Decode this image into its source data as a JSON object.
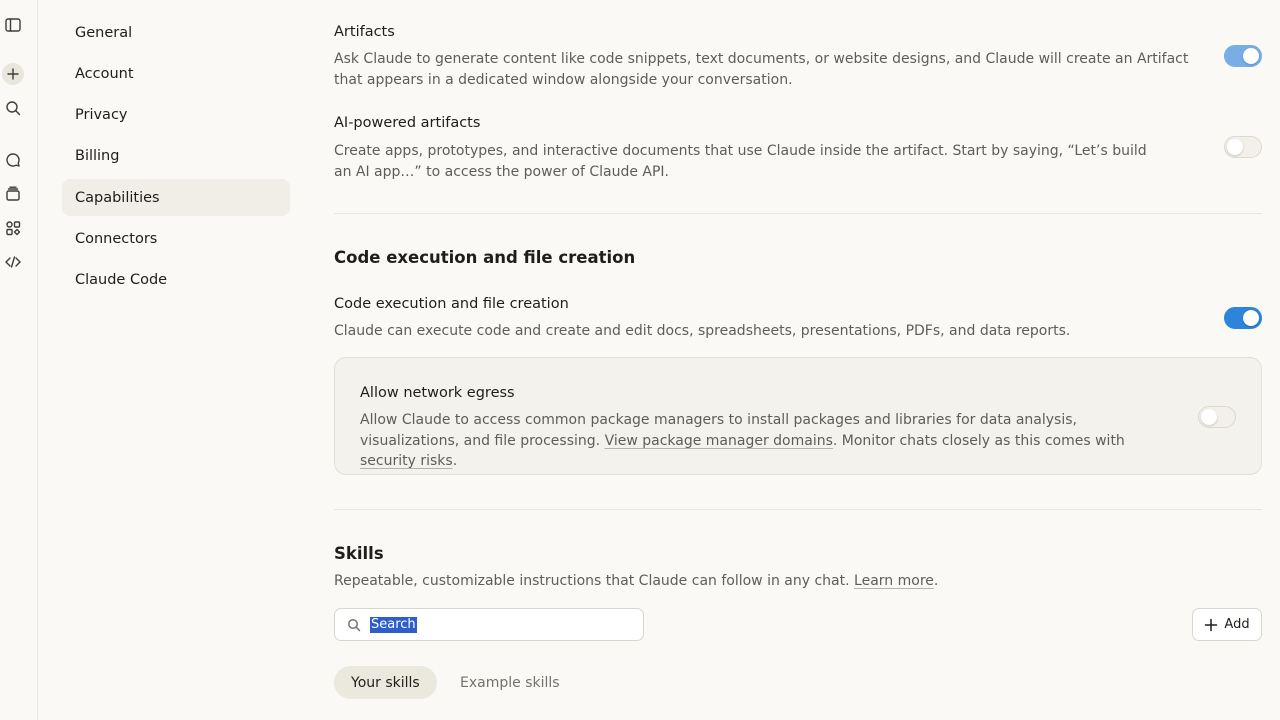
{
  "rail": {
    "icons": [
      "sidebar-toggle-icon",
      "new-chat-icon",
      "search-icon",
      "chats-icon",
      "projects-icon",
      "artifacts-icon",
      "code-icon"
    ]
  },
  "nav": {
    "items": [
      {
        "label": "General",
        "active": false
      },
      {
        "label": "Account",
        "active": false
      },
      {
        "label": "Privacy",
        "active": false
      },
      {
        "label": "Billing",
        "active": false
      },
      {
        "label": "Capabilities",
        "active": true
      },
      {
        "label": "Connectors",
        "active": false
      },
      {
        "label": "Claude Code",
        "active": false
      }
    ]
  },
  "artifacts": {
    "title": "Artifacts",
    "description": "Ask Claude to generate content like code snippets, text documents, or website designs, and Claude will create an Artifact that appears in a dedicated window alongside your conversation.",
    "enabled": true
  },
  "ai_artifacts": {
    "title": "AI-powered artifacts",
    "description": "Create apps, prototypes, and interactive documents that use Claude inside the artifact. Start by saying, “Let’s build an AI app…” to access the power of Claude API.",
    "enabled": false
  },
  "code_exec": {
    "heading": "Code execution and file creation",
    "title": "Code execution and file creation",
    "description": "Claude can execute code and create and edit docs, spreadsheets, presentations, PDFs, and data reports.",
    "enabled": true
  },
  "egress": {
    "title": "Allow network egress",
    "desc_before": "Allow Claude to access common package managers to install packages and libraries for data analysis, visualizations, and file processing. ",
    "link1": "View package manager domains",
    "desc_middle": ". Monitor chats closely as this comes with ",
    "link2": "security risks",
    "desc_after": ".",
    "enabled": false
  },
  "skills": {
    "heading": "Skills",
    "description": "Repeatable, customizable instructions that Claude can follow in any chat. ",
    "learn_more": "Learn more",
    "desc_end": ".",
    "search_placeholder": "Search",
    "add_label": "Add",
    "tabs": [
      {
        "label": "Your skills",
        "active": true
      },
      {
        "label": "Example skills",
        "active": false
      }
    ]
  },
  "colors": {
    "accent": "#2c84db",
    "background": "#faf9f5",
    "selection": "#2d5ec9"
  }
}
